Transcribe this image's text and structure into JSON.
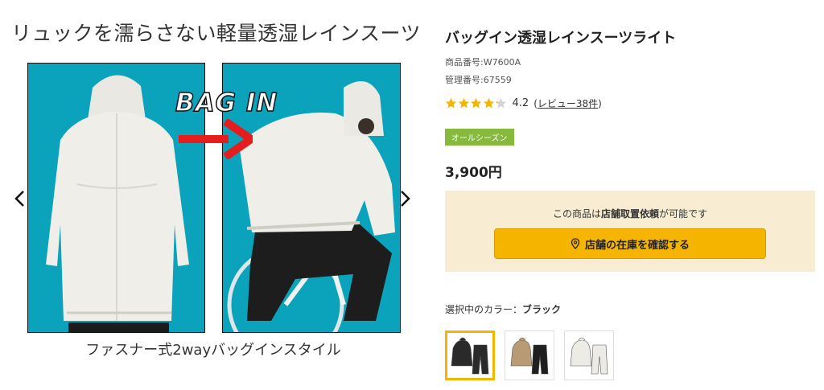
{
  "gallery": {
    "slide_title": "リュックを濡らさない軽量透湿レインスーツ",
    "overlay_text": "BAG IN",
    "caption": "ファスナー式2wayバッグインスタイル",
    "panel_color": "#0aa3bb",
    "prev_icon": "chevron-left-icon",
    "next_icon": "chevron-right-icon"
  },
  "product": {
    "title": "バッグイン透湿レインスーツライト",
    "item_number": "商品番号:W7600A",
    "control_number": "管理番号:67559",
    "rating": {
      "stars": 4.2,
      "max": 5,
      "score_text": "4.2",
      "open_paren": "(",
      "review_link": "レビュー38件",
      "close_paren": ")"
    },
    "season_badge": "オールシーズン",
    "price": "3,900円"
  },
  "store": {
    "text_before": "この商品は",
    "text_bold": "店舗取置依頼",
    "text_after": "が可能です",
    "button_label": "店舗の在庫を確認する",
    "button_icon": "location-pin-icon"
  },
  "colors": {
    "label": "選択中のカラー：",
    "selected": "ブラック",
    "swatches": [
      {
        "name": "ブラック",
        "hex": "#2a2a2a",
        "selected": true
      },
      {
        "name": "ベージュ",
        "hex": "#b89a74",
        "selected": false
      },
      {
        "name": "ホワイト",
        "hex": "#ecebe6",
        "selected": false
      }
    ]
  },
  "theme": {
    "accent": "#f5b400",
    "star_color": "#f5b400",
    "badge_color": "#86b93c",
    "store_bg": "#f8edd3"
  }
}
